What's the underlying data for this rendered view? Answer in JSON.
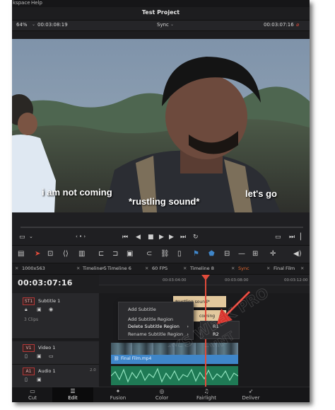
{
  "menu": {
    "items": [
      "kspace",
      "Help"
    ]
  },
  "app": {
    "title": "Test Project"
  },
  "viewer": {
    "zoom": "64%",
    "timecode_left": "00:03:08:19",
    "mode": "Sync",
    "timecode_right": "00:03:07:16"
  },
  "subtitles": {
    "left": "i am not coming",
    "center": "*rustling sound*",
    "right": "let's go"
  },
  "tabs": [
    "1000x563",
    "Timeline 5",
    "Timeline 6",
    "60 FPS",
    "Timeline 8",
    "Sync",
    "Final Film"
  ],
  "timeline": {
    "timecode": "00:03:07:16",
    "ruler": [
      "00:03:04:00",
      "00:03:08:00",
      "00:03:12:00"
    ]
  },
  "tracks": {
    "subtitle": {
      "badge": "ST1",
      "name": "Subtitle 1",
      "clips_count": "3 Clips"
    },
    "video": {
      "badge": "V1",
      "name": "Video 1",
      "clip": "Final Film.mp4"
    },
    "audio": {
      "badge": "A1",
      "name": "Audio 1",
      "level": "2.0"
    }
  },
  "subtitle_clips": {
    "top": "*rustling sound*",
    "bottom": "coming"
  },
  "context_menu": {
    "items": [
      "Add Subtitle",
      "Add Subtitle Region",
      "Delete Subtitle Region",
      "Rename Subtitle Region"
    ],
    "submenu": [
      "R1",
      "R2"
    ]
  },
  "pages": [
    "Cut",
    "Edit",
    "Fusion",
    "Color",
    "Fairlight",
    "Deliver"
  ],
  "active_page": "Edit",
  "colors": {
    "playhead": "#e14b3b",
    "subtitle_clip": "#e2c89d",
    "video_clip": "#3f86c9",
    "audio_clip": "#1f7a55",
    "sync_tab": "#e2662e"
  },
  "watermark": "GEEKS WEEK PRO ACCOUNT"
}
